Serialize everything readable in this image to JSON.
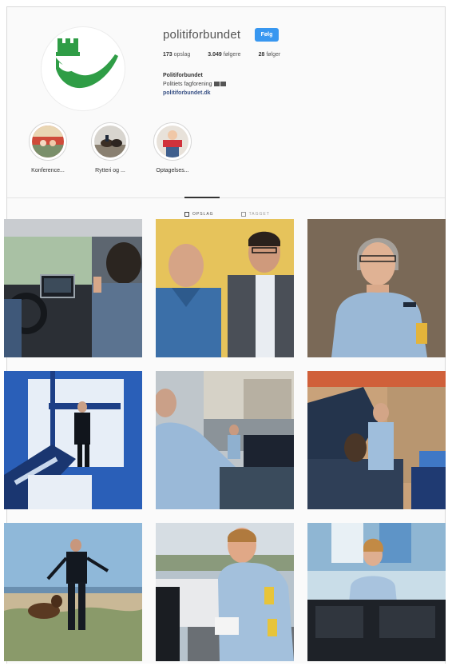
{
  "profile": {
    "username": "politiforbundet",
    "follow_label": "Følg",
    "stats": {
      "posts_value": "173",
      "posts_label": "opslag",
      "followers_value": "3.049",
      "followers_label": "følgere",
      "following_value": "28",
      "following_label": "følger"
    },
    "bio": {
      "name": "Politiforbundet",
      "tagline": "Politiets fagforening",
      "link": "politiforbundet.dk"
    }
  },
  "highlights": [
    {
      "label": "Konference..."
    },
    {
      "label": "Rytteri og ..."
    },
    {
      "label": "Optagelses..."
    }
  ],
  "tabs": [
    {
      "label": "OPSLAG"
    },
    {
      "label": "TAGGET"
    }
  ],
  "colors": {
    "accent": "#3897f0",
    "logo_green": "#2f9d46",
    "link": "#385185"
  },
  "posts": [
    {
      "icon": "post-police-car-interior"
    },
    {
      "icon": "post-two-men-portrait"
    },
    {
      "icon": "post-female-officer"
    },
    {
      "icon": "post-officer-stairwell"
    },
    {
      "icon": "post-officers-at-car"
    },
    {
      "icon": "post-officer-with-dog-car"
    },
    {
      "icon": "post-officer-dog-beach"
    },
    {
      "icon": "post-officer-writing"
    },
    {
      "icon": "post-officer-dispatch"
    }
  ]
}
